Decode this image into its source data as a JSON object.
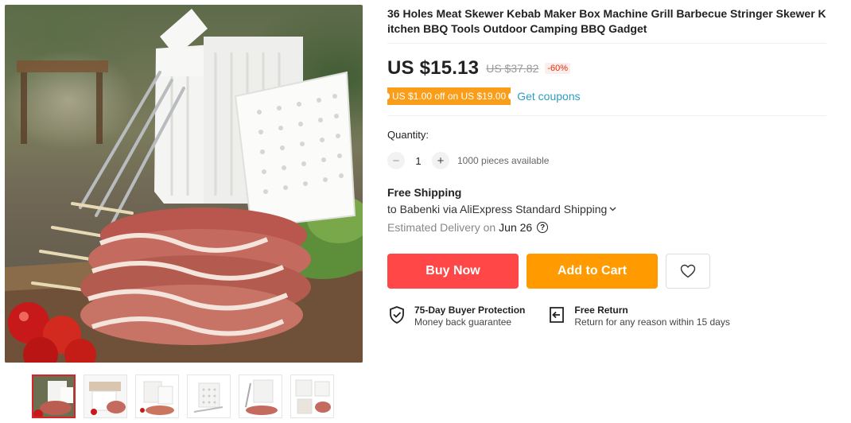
{
  "product": {
    "title": "36 Holes Meat Skewer Kebab Maker Box Machine Grill Barbecue Stringer Skewer Kitchen BBQ Tools Outdoor Camping BBQ Gadget",
    "main_image": "kebab-skewer-maker-box-photo",
    "thumbnails": [
      {
        "name": "thumb-1",
        "selected": true
      },
      {
        "name": "thumb-2",
        "selected": false
      },
      {
        "name": "thumb-3",
        "selected": false
      },
      {
        "name": "thumb-4",
        "selected": false
      },
      {
        "name": "thumb-5",
        "selected": false
      },
      {
        "name": "thumb-6",
        "selected": false
      }
    ]
  },
  "price": {
    "current": "US $15.13",
    "original": "US $37.82",
    "discount": "-60%"
  },
  "coupon": {
    "badge": "US $1.00 off on US $19.00",
    "link": "Get coupons"
  },
  "quantity": {
    "label": "Quantity:",
    "minus": "−",
    "value": "1",
    "plus": "+",
    "available": "1000 pieces available"
  },
  "shipping": {
    "title": "Free Shipping",
    "line": "to Babenki via AliExpress Standard Shipping",
    "chevron_icon": "chevron-down-icon",
    "delivery_label": "Estimated Delivery on",
    "delivery_date": "Jun 26",
    "help_icon": "question-circle-icon"
  },
  "actions": {
    "buy_now": "Buy Now",
    "add_to_cart": "Add to Cart",
    "wishlist_icon": "heart-icon"
  },
  "guarantees": [
    {
      "icon": "shield-check-icon",
      "title": "75-Day Buyer Protection",
      "subtitle": "Money back guarantee"
    },
    {
      "icon": "return-box-icon",
      "title": "Free Return",
      "subtitle": "Return for any reason within 15 days"
    }
  ],
  "colors": {
    "buy_now": "#ff4747",
    "add_to_cart": "#ff9a00",
    "coupon": "#fa9d19",
    "link": "#2e9cc3",
    "discount": "#e62e04",
    "selected_thumb_border": "#d8232a"
  }
}
